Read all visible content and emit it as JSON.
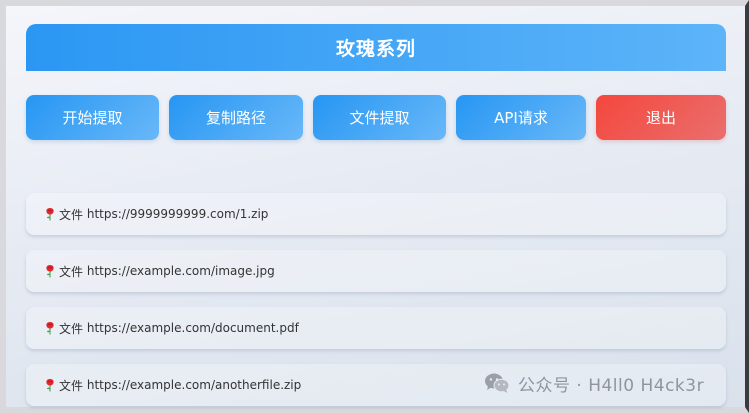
{
  "window": {
    "title": "玫瑰系列"
  },
  "toolbar": {
    "buttons": [
      {
        "label": "开始提取"
      },
      {
        "label": "复制路径"
      },
      {
        "label": "文件提取"
      },
      {
        "label": "API请求"
      },
      {
        "label": "退出"
      }
    ]
  },
  "list": {
    "items": [
      {
        "prefix": "文件",
        "url": "https://9999999999.com/1.zip"
      },
      {
        "prefix": "文件",
        "url": "https://example.com/image.jpg"
      },
      {
        "prefix": "文件",
        "url": "https://example.com/document.pdf"
      },
      {
        "prefix": "文件",
        "url": "https://example.com/anotherfile.zip"
      }
    ],
    "item_icon": "rose-icon"
  },
  "watermark": {
    "text": "公众号 · H4ll0 H4ck3r",
    "icon": "wechat-icon"
  },
  "colors": {
    "accent": "#2b97f3",
    "accent_light": "#5db4f9",
    "exit": "#f4473d",
    "text": "#333333"
  }
}
